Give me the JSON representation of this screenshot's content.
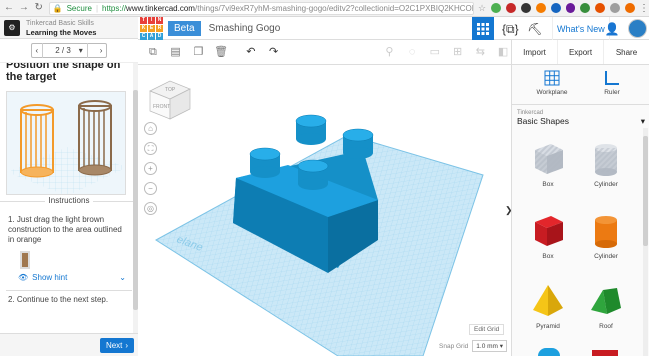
{
  "browser": {
    "secure_label": "Secure",
    "url_proto": "https://",
    "url_host": "www.tinkercad.com",
    "url_rest": "/things/7vi9exR7yhM-smashing-gogo/editv2?collectionid=O2C1PXBIQ2KHCOD&lessonid=EA"
  },
  "lesson": {
    "category": "Tinkercad Basic Skills",
    "title": "Learning the Moves",
    "page": "2 / 3",
    "heading": "Position the shape on the target",
    "instructions_label": "Instructions",
    "step1": "1. Just drag the light brown construction to the area outlined in orange",
    "hint": "Show hint",
    "step2": "2. Continue to the next step.",
    "next": "Next"
  },
  "appbar": {
    "logo_letters": [
      "TIN",
      "KER",
      "CAD"
    ],
    "logo_cells": [
      "T",
      "I",
      "N",
      "K",
      "E",
      "R",
      "C",
      "A",
      "D"
    ],
    "beta": "Beta",
    "design_name": "Smashing Gogo",
    "whats_new": "What's New"
  },
  "right": {
    "import": "Import",
    "export": "Export",
    "share": "Share",
    "workplane": "Workplane",
    "ruler": "Ruler",
    "category_sub": "Tinkercad",
    "category": "Basic Shapes",
    "shapes": [
      "Box",
      "Cylinder",
      "Box",
      "Cylinder",
      "Pyramid",
      "Roof"
    ]
  },
  "workspace": {
    "viewcube_top": "TOP",
    "viewcube_front": "FRONT",
    "plane_text": "elane",
    "edit_grid": "Edit Grid",
    "snap_grid": "Snap Grid",
    "snap_value": "1.0 mm"
  },
  "colors": {
    "accent": "#1477d1",
    "brick": "#1a9ed6",
    "grid": "#bfe3f5"
  }
}
